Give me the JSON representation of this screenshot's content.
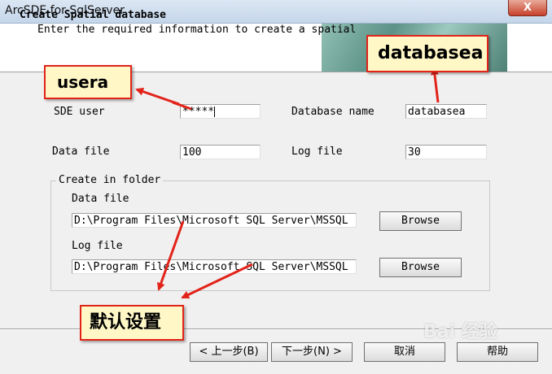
{
  "window": {
    "title": "ArcSDE for SqlServer",
    "close_glyph": "X"
  },
  "header": {
    "title": "Create Spatial database",
    "subtitle": "Enter the required information to create a spatial"
  },
  "form": {
    "sde_user_label": "SDE user",
    "sde_user_value": "*****",
    "database_name_label": "Database name",
    "database_name_value": "databasea",
    "data_file_label": "Data file",
    "data_file_value": "100",
    "log_file_label": "Log file",
    "log_file_value": "30"
  },
  "folder_group": {
    "legend": "Create in folder",
    "data_file_label": "Data file",
    "data_file_path": "D:\\Program Files\\Microsoft SQL Server\\MSSQL",
    "data_browse_label": "Browse",
    "log_file_label": "Log file",
    "log_file_path": "D:\\Program Files\\Microsoft SQL Server\\MSSQL",
    "log_browse_label": "Browse"
  },
  "footer": {
    "back_label": "< 上一步(B)",
    "next_label": "下一步(N) >",
    "cancel_label": "取消",
    "help_label": "帮助"
  },
  "annotations": {
    "callout_user": "usera",
    "callout_db": "databasea",
    "callout_default": "默认设置",
    "watermark": "Bai 经验",
    "border_color": "#e2231a",
    "fill_color": "#fff7c6"
  }
}
